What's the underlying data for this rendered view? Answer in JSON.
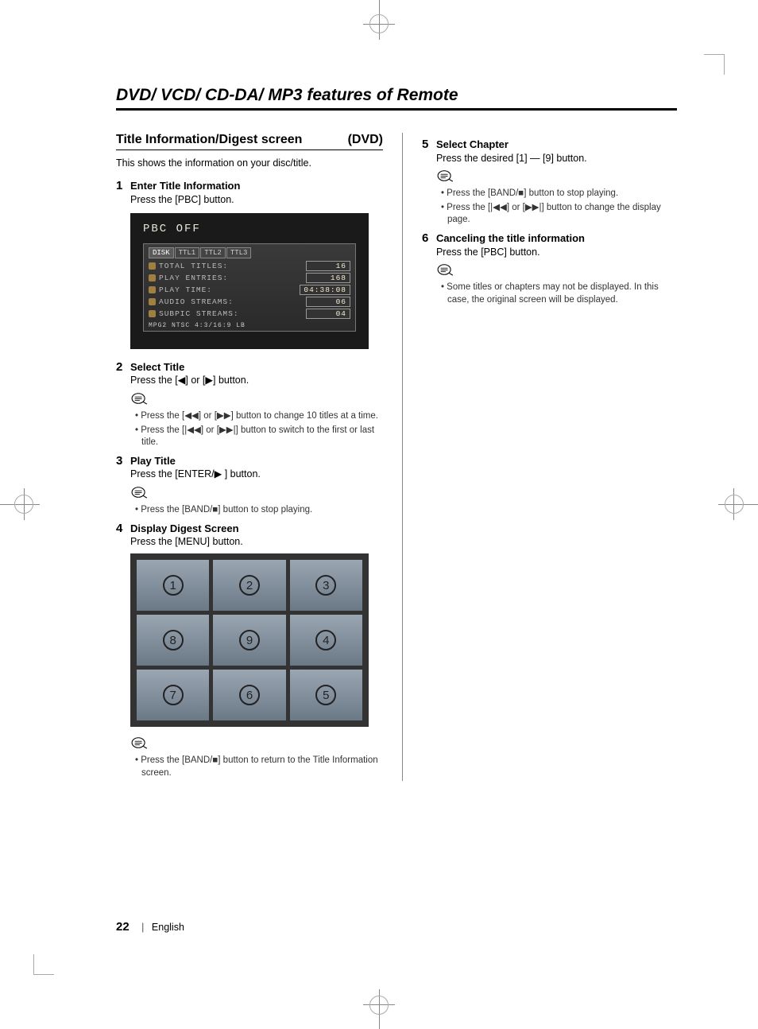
{
  "chapter_title": "DVD/ VCD/ CD-DA/ MP3 features of Remote",
  "section": {
    "title_left": "Title Information/Digest screen",
    "title_right": "(DVD)",
    "intro": "This shows the information on your disc/title."
  },
  "pbc": {
    "header": "PBC OFF",
    "tabs": [
      "DISK",
      "TTL1",
      "TTL2",
      "TTL3"
    ],
    "rows": [
      {
        "label": "TOTAL TITLES:",
        "value": "16"
      },
      {
        "label": "PLAY ENTRIES:",
        "value": "168"
      },
      {
        "label": "PLAY TIME:",
        "value": "04:38:08"
      },
      {
        "label": "AUDIO STREAMS:",
        "value": "06"
      },
      {
        "label": "SUBPIC STREAMS:",
        "value": "04"
      }
    ],
    "footer": "MPG2 NTSC 4:3/16:9 LB"
  },
  "digest_order": [
    "1",
    "2",
    "3",
    "8",
    "9",
    "4",
    "7",
    "6",
    "5"
  ],
  "steps_left": [
    {
      "num": "1",
      "heading": "Enter Title Information",
      "sub": "Press the [PBC] button."
    },
    {
      "num": "2",
      "heading": "Select Title",
      "sub_parts": [
        "Press the [",
        "◀",
        "] or [",
        "▶",
        "] button."
      ],
      "notes": [
        "Press the [◀◀] or [▶▶] button to change 10 titles at a time.",
        "Press the [|◀◀] or [▶▶|] button to switch to the first or last title."
      ]
    },
    {
      "num": "3",
      "heading": "Play Title",
      "sub_parts": [
        "Press the [ENTER/",
        "▶",
        " ] button."
      ],
      "notes": [
        "Press the [BAND/■] button to stop playing."
      ]
    },
    {
      "num": "4",
      "heading": "Display Digest Screen",
      "sub": "Press the [MENU] button.",
      "notes_after": [
        "Press the [BAND/■] button to return to the Title Information screen."
      ]
    }
  ],
  "steps_right": [
    {
      "num": "5",
      "heading": "Select Chapter",
      "sub": "Press the desired [1] — [9] button.",
      "notes": [
        "Press the [BAND/■] button to stop playing.",
        "Press the [|◀◀] or [▶▶|] button to change the display page."
      ]
    },
    {
      "num": "6",
      "heading": "Canceling the title information",
      "sub": "Press the [PBC] button.",
      "notes": [
        "Some titles or chapters may not be displayed. In this case, the original screen will be displayed."
      ]
    }
  ],
  "footer": {
    "pagenum": "22",
    "lang": "English"
  }
}
